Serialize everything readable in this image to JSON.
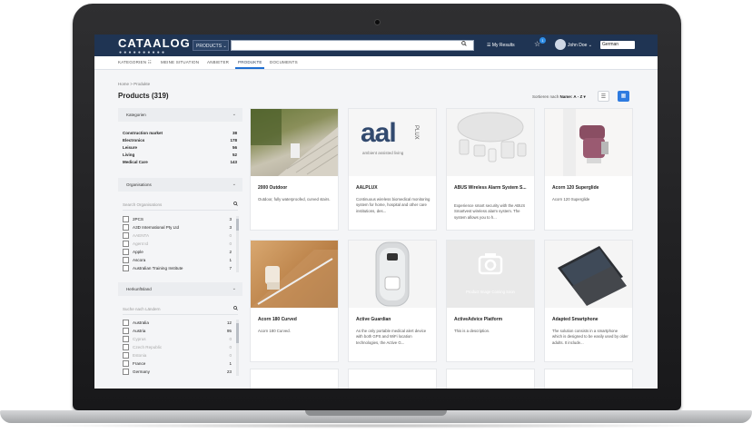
{
  "header": {
    "logo": "CATAALOG",
    "logo_dots": "●●●●●●●●●●",
    "product_select": "PRODUCTS ⌄",
    "search_icon": "🔍",
    "my_results": "☰ My Results",
    "badge_count": "1",
    "user": "John Doe ⌄",
    "language": "German"
  },
  "nav": {
    "items": [
      "KATEGORIEN ☷",
      "MEINE SITUATION",
      "ANBIETER",
      "PRODUKTE",
      "DOCUMENTS"
    ]
  },
  "breadcrumb": "Home  >  Produkte",
  "page_title": "Products (319)",
  "sort": {
    "label": "Sortieren nach",
    "value": "Name: A - Z ▾"
  },
  "categories": {
    "title": "Kategorien",
    "items": [
      {
        "label": "Construction market",
        "count": "38"
      },
      {
        "label": "Electronics",
        "count": "178"
      },
      {
        "label": "Leisure",
        "count": "56"
      },
      {
        "label": "Living",
        "count": "52"
      },
      {
        "label": "Medical Care",
        "count": "143"
      }
    ]
  },
  "organisations": {
    "title": "Organisations",
    "placeholder": "Search Organisations",
    "items": [
      {
        "label": "2PCS",
        "count": "3",
        "muted": false
      },
      {
        "label": "A3D International Pty Ltd",
        "count": "3",
        "muted": false
      },
      {
        "label": "AAENTA",
        "count": "0",
        "muted": true
      },
      {
        "label": "Agent Id",
        "count": "0",
        "muted": true
      },
      {
        "label": "Apple",
        "count": "2",
        "muted": false
      },
      {
        "label": "Ascora",
        "count": "1",
        "muted": false
      },
      {
        "label": "Australian Training Institute",
        "count": "7",
        "muted": false
      }
    ]
  },
  "origin": {
    "title": "Herkunftsland",
    "placeholder": "Suche nach Ländern",
    "items": [
      {
        "label": "Australia",
        "count": "12",
        "muted": false
      },
      {
        "label": "Austria",
        "count": "95",
        "muted": false
      },
      {
        "label": "Cyprus",
        "count": "0",
        "muted": true
      },
      {
        "label": "Czech Republic",
        "count": "0",
        "muted": true
      },
      {
        "label": "Estonia",
        "count": "0",
        "muted": true
      },
      {
        "label": "France",
        "count": "1",
        "muted": false
      },
      {
        "label": "Germany",
        "count": "23",
        "muted": false
      }
    ]
  },
  "products": [
    {
      "title": "2000 Outdoor",
      "desc": "Outdoor, fully waterproofed, curved stairs."
    },
    {
      "title": "AALPLUX",
      "desc": "Continuous wireless biomedical monitoring system for home, hospital and other care institutions, des..."
    },
    {
      "title": "ABUS Wireless Alarm System S...",
      "desc": "Experience smart security with the ABUS Smartvest wireless alarm system. The system allows you to h..."
    },
    {
      "title": "Acorn 120 Superglide",
      "desc": "Acorn 120 Superglide"
    },
    {
      "title": "Acorn 180 Curved",
      "desc": "Acorn 180 Curved."
    },
    {
      "title": "Active Guardian",
      "desc": "As the only portable medical alert device with both GPS and WiFi location technologies, the Active G..."
    },
    {
      "title": "ActiveAdvice Platform",
      "desc": "This is a description."
    },
    {
      "title": "Adapted Smartphone",
      "desc": "The solution consists in a smartphone which is designed to be easily used by older adults. It include..."
    }
  ],
  "aal_logo": {
    "text": "aal",
    "side": "PLUX",
    "sub": "ambient assisted living"
  },
  "placeholder_text": "Product Image Coming Soon",
  "colors": {
    "header_bg": "#1f3453",
    "accent": "#2e7be0"
  }
}
